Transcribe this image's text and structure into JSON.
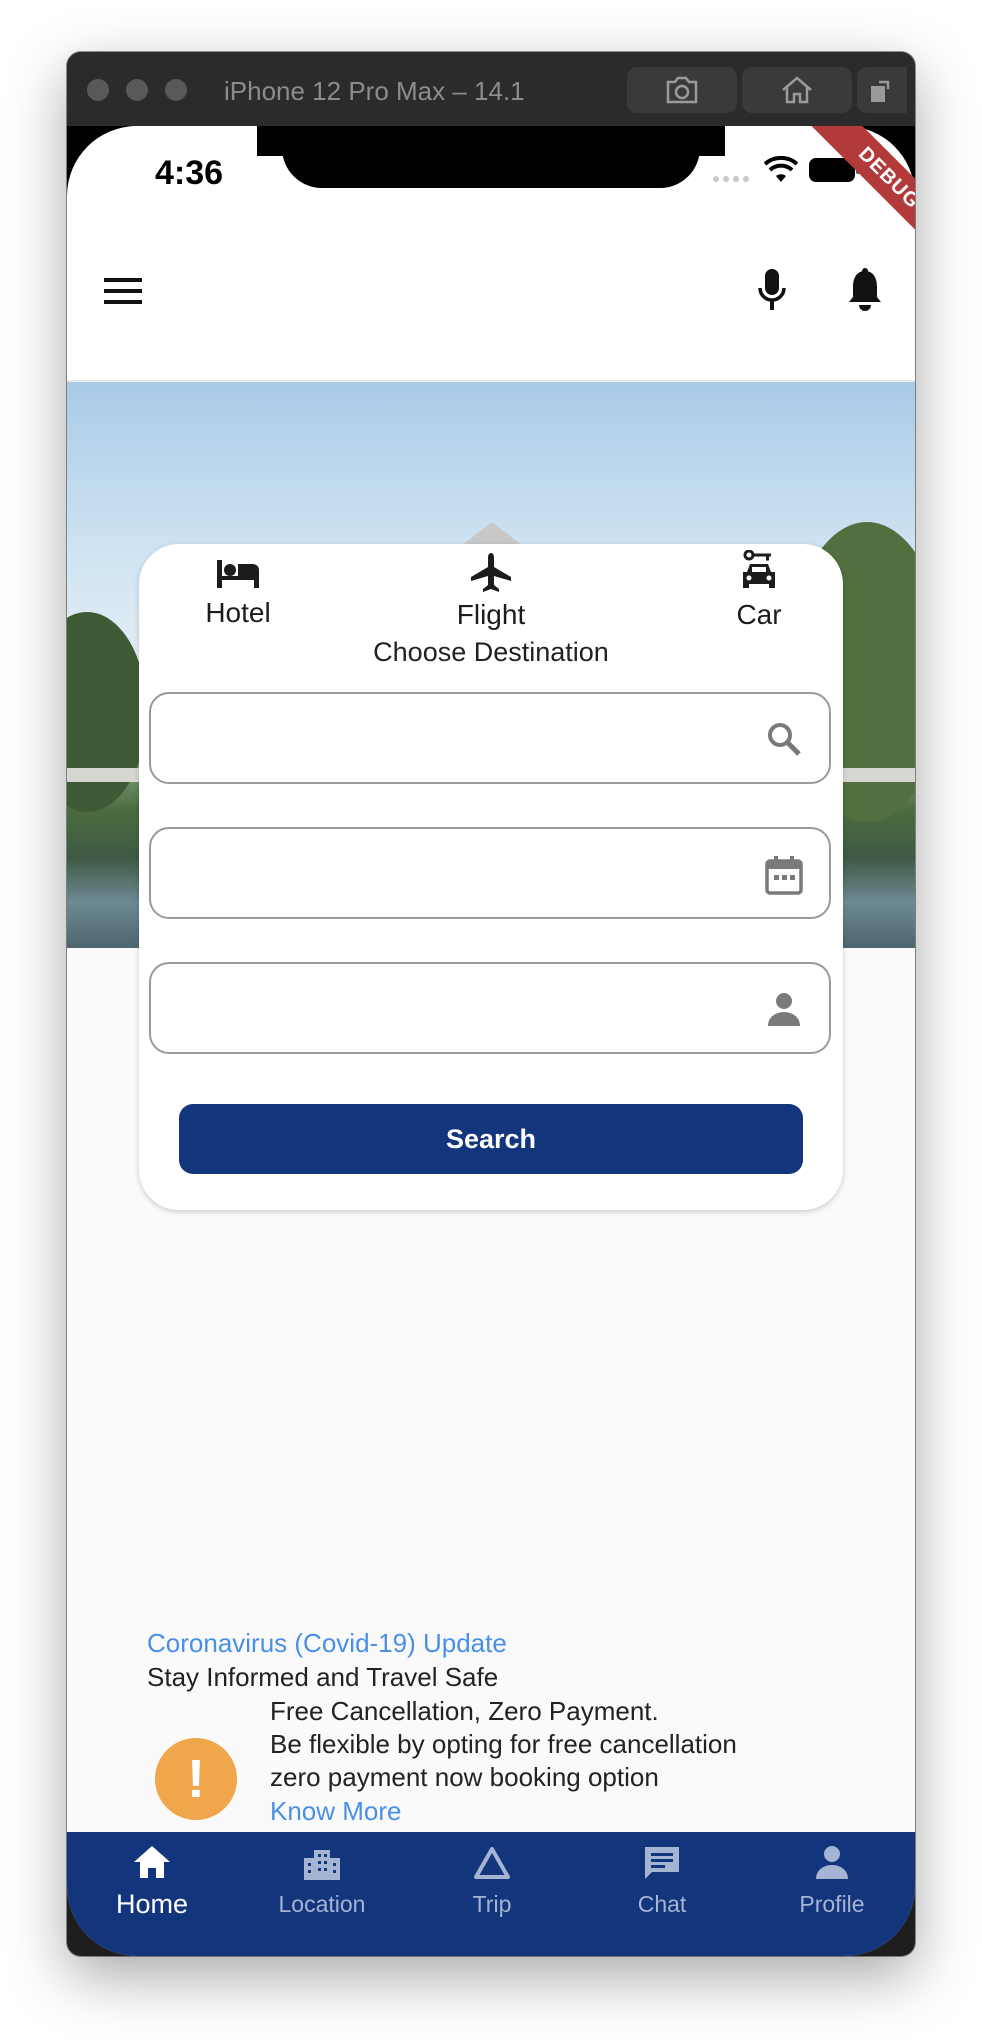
{
  "simulator": {
    "title": "iPhone 12 Pro Max – 14.1"
  },
  "status_bar": {
    "time": "4:36"
  },
  "debug_banner": "DEBUG",
  "search_card": {
    "tabs": [
      {
        "label": "Hotel",
        "icon": "bed-icon"
      },
      {
        "label": "Flight",
        "icon": "airplane-icon"
      },
      {
        "label": "Car",
        "icon": "car-icon"
      }
    ],
    "choose_label": "Choose Destination",
    "destination_value": "",
    "date_value": "",
    "guests_value": "",
    "search_label": "Search"
  },
  "covid": {
    "title": "Coronavirus (Covid-19) Update",
    "subtitle": "Stay Informed and Travel Safe",
    "lines": [
      "Free Cancellation, Zero Payment.",
      "Be flexible by opting for free cancellation",
      "zero payment now booking option"
    ],
    "link": "Know More"
  },
  "bottom_nav": [
    {
      "label": "Home",
      "icon": "home-icon",
      "active": true
    },
    {
      "label": "Location",
      "icon": "location-city-icon",
      "active": false
    },
    {
      "label": "Trip",
      "icon": "triangle-icon",
      "active": false
    },
    {
      "label": "Chat",
      "icon": "chat-icon",
      "active": false
    },
    {
      "label": "Profile",
      "icon": "person-icon",
      "active": false
    }
  ],
  "colors": {
    "primary": "#12357c",
    "link": "#4a8fe7",
    "warning": "#f0a64a"
  }
}
